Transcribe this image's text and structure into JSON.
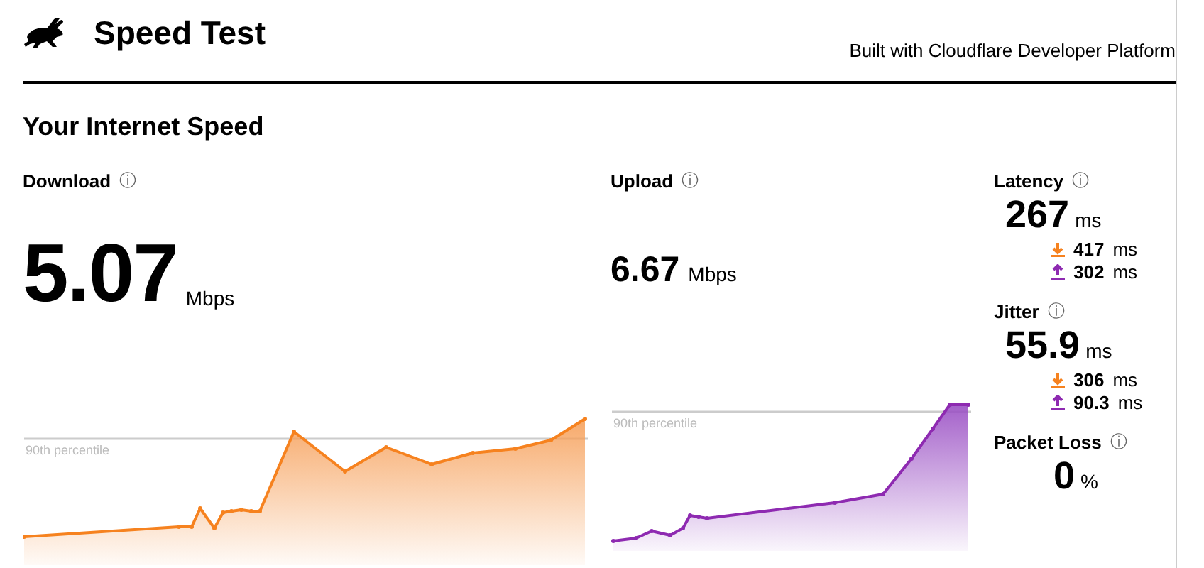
{
  "header": {
    "title": "Speed Test",
    "credit": "Built with Cloudflare Developer Platform"
  },
  "section_title": "Your Internet Speed",
  "download": {
    "label": "Download",
    "info": "ⓘ",
    "value": "5.07",
    "unit": "Mbps",
    "percentile_label": "90th percentile"
  },
  "upload": {
    "label": "Upload",
    "info": "ⓘ",
    "value": "6.67",
    "unit": "Mbps",
    "percentile_label": "90th percentile"
  },
  "metrics": [
    {
      "label": "Latency",
      "info": "ⓘ",
      "value": "267",
      "unit": "ms",
      "details": [
        {
          "kind": "down",
          "value": "417",
          "unit": "ms"
        },
        {
          "kind": "up",
          "value": "302",
          "unit": "ms"
        }
      ]
    },
    {
      "label": "Jitter",
      "info": "ⓘ",
      "value": "55.9",
      "unit": "ms",
      "details": [
        {
          "kind": "down",
          "value": "306",
          "unit": "ms"
        },
        {
          "kind": "up",
          "value": "90.3",
          "unit": "ms"
        }
      ]
    },
    {
      "label": "Packet Loss",
      "info": "ⓘ",
      "value": "0",
      "unit": "%"
    }
  ]
}
